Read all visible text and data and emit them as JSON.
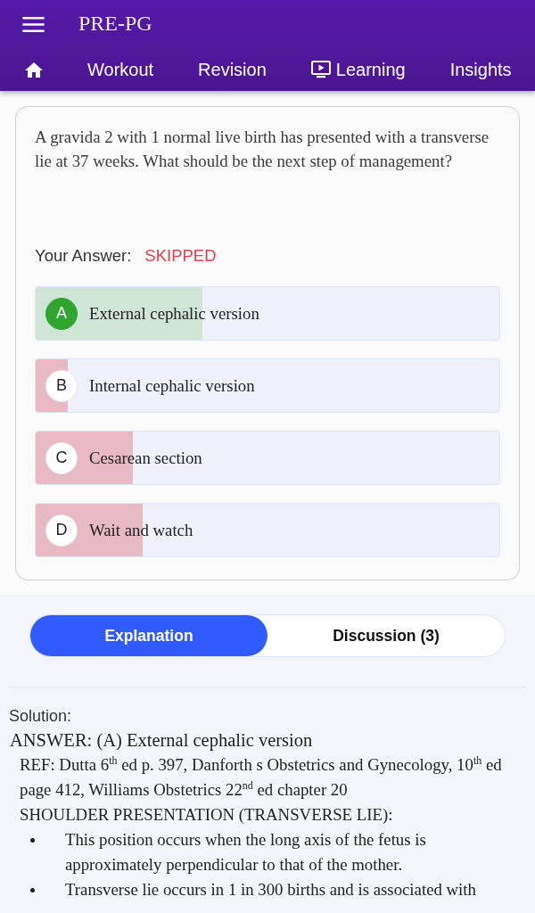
{
  "app_bar": {
    "title": "PRE-PG"
  },
  "nav_tabs": [
    {
      "kind": "icon_only",
      "selected": false
    },
    {
      "kind": "text",
      "label": "Workout",
      "selected": false
    },
    {
      "kind": "text",
      "label": "Revision",
      "selected": false
    },
    {
      "kind": "icon_text",
      "label": "Learning",
      "selected": false
    },
    {
      "kind": "text",
      "label": "Insights",
      "selected": false
    }
  ],
  "question": {
    "text": "A gravida 2 with 1 normal live birth has presented with a transverse lie at 37 weeks. What should be the next step of management?",
    "answer_label": "Your Answer:",
    "answer_value": "SKIPPED"
  },
  "options": [
    {
      "letter": "A",
      "text": "External cephalic version",
      "correct": true,
      "level": 0.36
    },
    {
      "letter": "B",
      "text": "Internal cephalic version",
      "correct": false,
      "level": 0.07
    },
    {
      "letter": "C",
      "text": "Cesarean section",
      "correct": false,
      "level": 0.21
    },
    {
      "letter": "D",
      "text": "Wait and watch",
      "correct": false,
      "level": 0.23
    }
  ],
  "detail_tabs": [
    {
      "label": "Explanation",
      "selected": true
    },
    {
      "label": "Discussion (3)",
      "selected": false
    }
  ],
  "solution": {
    "heading": "Solution:",
    "answer": "ANSWER: (A) External cephalic version",
    "reference": "REF: Dutta 6$^{th}$ ed p. 397, Danforth s Obstetrics and Gynecology, 10$^{th}$ ed page 412, Williams Obstetrics 22$^{nd}$ ed chapter 20",
    "section_title": "SHOULDER PRESENTATION (TRANSVERSE LIE):",
    "bullets": [
      "This position occurs when the long axis of the fetus is approximately perpendicular to that of the mother.",
      "Transverse lie occurs in 1 in 300 births and is associated with"
    ]
  }
}
